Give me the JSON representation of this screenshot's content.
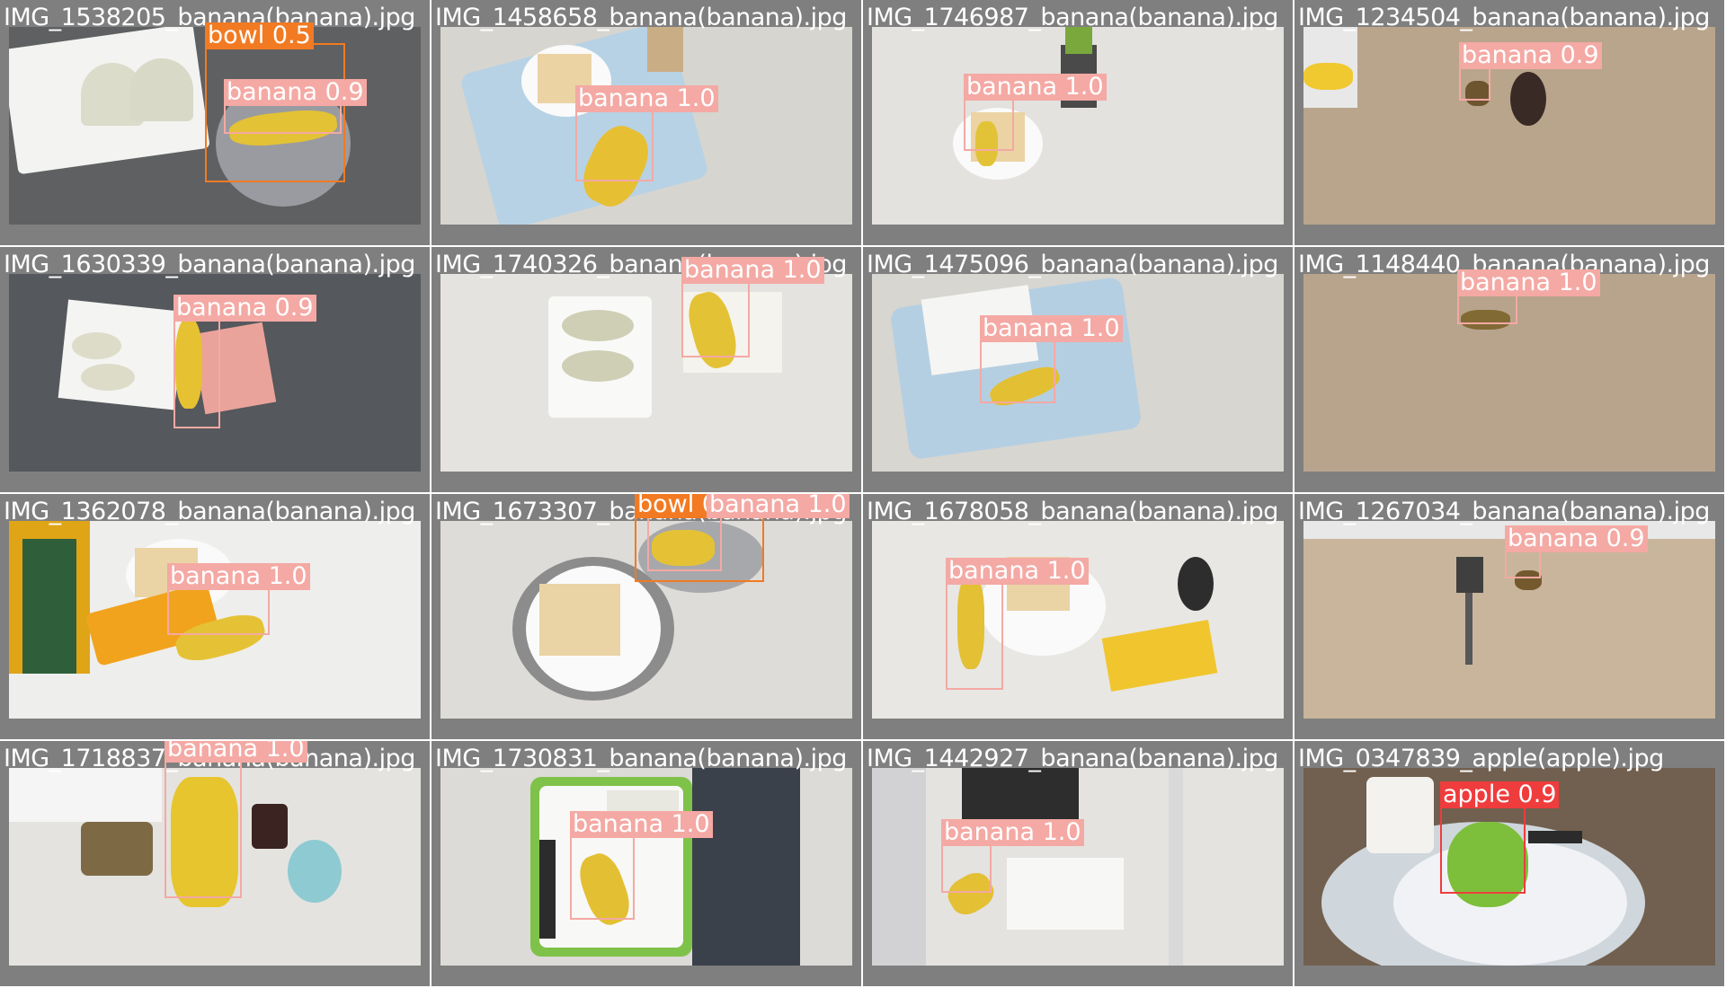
{
  "colors": {
    "background_gray": "#7f7f7f",
    "banana_box": "#f4a9a4",
    "bowl_box": "#f27a22",
    "apple_box": "#ef3c3c"
  },
  "tiles": [
    {
      "filename": "IMG_1538205_banana(banana).jpg",
      "detections": [
        {
          "label": "bowl 0.5",
          "class": "bowl"
        },
        {
          "label": "banana 0.9",
          "class": "banana"
        }
      ]
    },
    {
      "filename": "IMG_1458658_banana(banana).jpg",
      "detections": [
        {
          "label": "banana 1.0",
          "class": "banana"
        }
      ]
    },
    {
      "filename": "IMG_1746987_banana(banana).jpg",
      "detections": [
        {
          "label": "banana 1.0",
          "class": "banana"
        }
      ]
    },
    {
      "filename": "IMG_1234504_banana(banana).jpg",
      "detections": [
        {
          "label": "banana 0.9",
          "class": "banana"
        }
      ]
    },
    {
      "filename": "IMG_1630339_banana(banana).jpg",
      "detections": [
        {
          "label": "banana 0.9",
          "class": "banana"
        }
      ]
    },
    {
      "filename": "IMG_1740326_banana(banana).jpg",
      "detections": [
        {
          "label": "banana 1.0",
          "class": "banana"
        }
      ]
    },
    {
      "filename": "IMG_1475096_banana(banana).jpg",
      "detections": [
        {
          "label": "banana 1.0",
          "class": "banana"
        }
      ]
    },
    {
      "filename": "IMG_1148440_banana(banana).jpg",
      "detections": [
        {
          "label": "banana 1.0",
          "class": "banana"
        }
      ]
    },
    {
      "filename": "IMG_1362078_banana(banana).jpg",
      "detections": [
        {
          "label": "banana 1.0",
          "class": "banana"
        }
      ]
    },
    {
      "filename": "IMG_1673307_banana(banana).jpg",
      "detections": [
        {
          "label": "bowl 0.3",
          "class": "bowl"
        },
        {
          "label": "banana 1.0",
          "class": "banana"
        }
      ]
    },
    {
      "filename": "IMG_1678058_banana(banana).jpg",
      "detections": [
        {
          "label": "banana 1.0",
          "class": "banana"
        }
      ]
    },
    {
      "filename": "IMG_1267034_banana(banana).jpg",
      "detections": [
        {
          "label": "banana 0.9",
          "class": "banana"
        }
      ]
    },
    {
      "filename": "IMG_1718837_banana(banana).jpg",
      "detections": [
        {
          "label": "banana 1.0",
          "class": "banana"
        }
      ]
    },
    {
      "filename": "IMG_1730831_banana(banana).jpg",
      "detections": [
        {
          "label": "banana 1.0",
          "class": "banana"
        }
      ]
    },
    {
      "filename": "IMG_1442927_banana(banana).jpg",
      "detections": [
        {
          "label": "banana 1.0",
          "class": "banana"
        }
      ]
    },
    {
      "filename": "IMG_0347839_apple(apple).jpg",
      "detections": [
        {
          "label": "apple 0.9",
          "class": "apple"
        }
      ]
    }
  ]
}
